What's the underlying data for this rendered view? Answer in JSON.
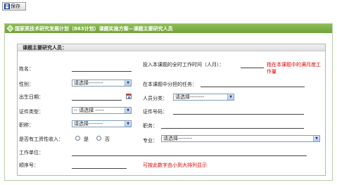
{
  "toolbar": {
    "save_label": "保存",
    "save_icon": "floppy-disk-icon"
  },
  "panel": {
    "title": "国家高技术研究发展计划（863计划）课题实施方案—课题主要研究人员",
    "header_color": "#7fb14a"
  },
  "section": {
    "title": "课题主要研究人员："
  },
  "fields": {
    "name_label": "姓名：",
    "worktime_label": "投入本课题的全时工作时间（人月）：",
    "worktime_hint": "指在本课题中的满月度工作量",
    "gender_label": "性别：",
    "gender_value": "请选择--------",
    "task_label": "在本课题中分担的任务：",
    "birth_label": "出生日期：",
    "category_label": "人员分类：",
    "category_value": "请选择--------",
    "idtype_label": "证件类型：",
    "idtype_value": "-- 请选择 -----",
    "idno_label": "证件号码：",
    "title_label": "职称：",
    "title_value": "请选择--------",
    "post_label": "职务：",
    "salary_label": "是否有工资性收入：",
    "radio_yes": "是",
    "radio_no": "否",
    "major_label": "专业：",
    "major_value": "请选择--------",
    "unit_label": "工作单位：",
    "order_label": "顺序号：",
    "order_hint": "可按此数字由小到大排列显示"
  },
  "colors": {
    "hint_red": "#dd0000",
    "select_border": "#7f9db9"
  }
}
